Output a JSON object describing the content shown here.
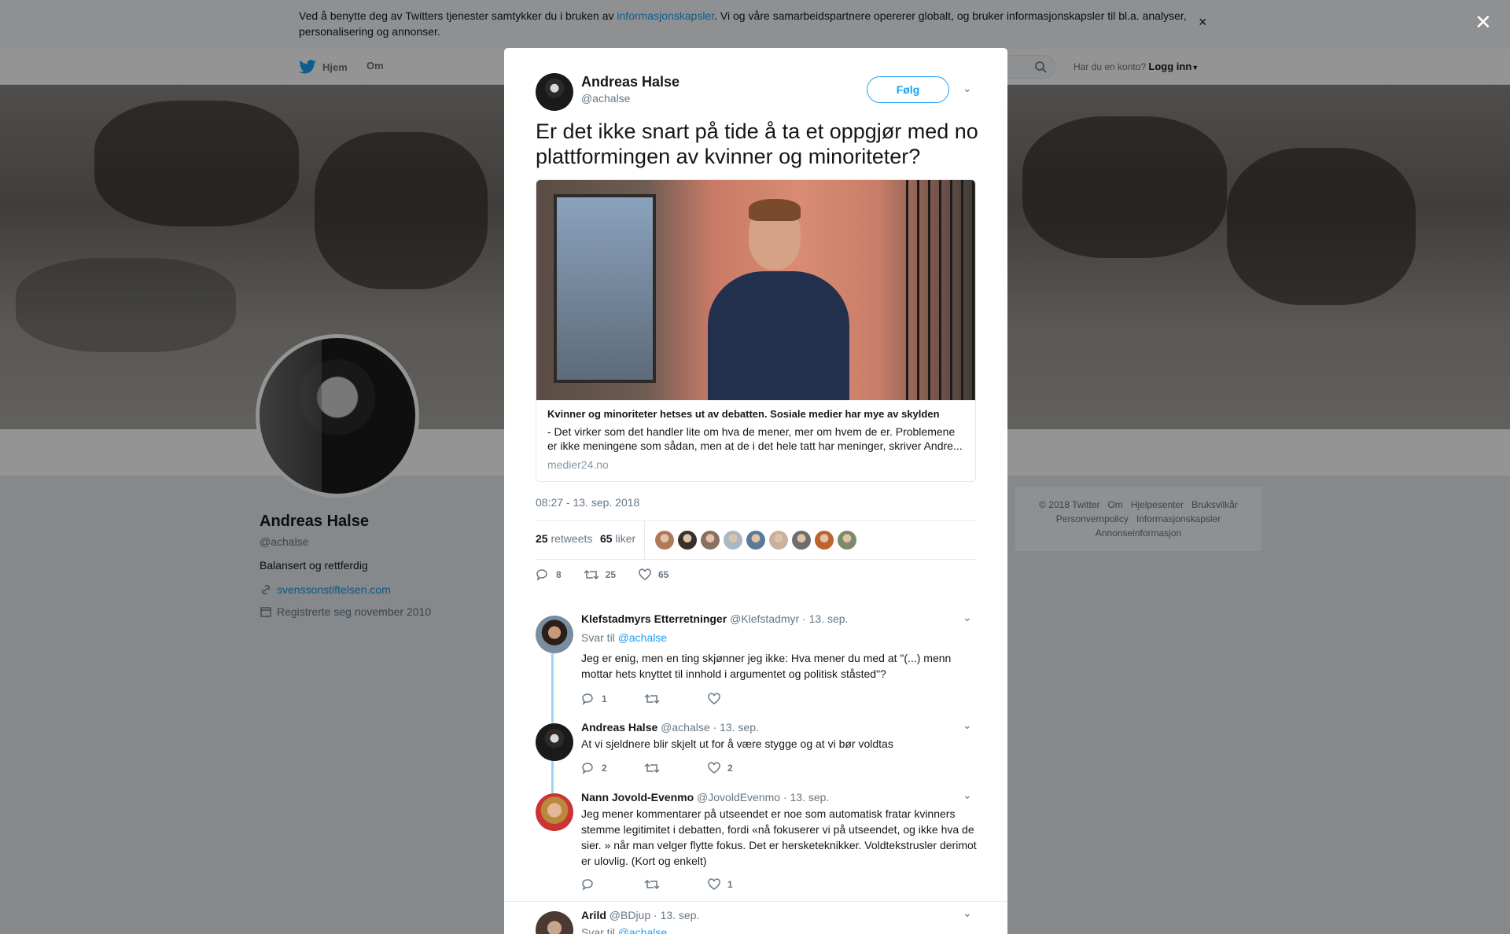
{
  "cookie": {
    "text_before": "Ved å benytte deg av Twitters tjenester samtykker du i bruken av ",
    "link": "informasjonskapsler",
    "text_after": ". Vi og våre samarbeidspartnere opererer globalt, og bruker informasjonskapsler til bl.a. analyser, personalisering og annonser.",
    "close": "×"
  },
  "nav": {
    "home": "Hjem",
    "about": "Om",
    "have_account": "Har du en konto?",
    "login": "Logg inn"
  },
  "profile": {
    "name": "Andreas Halse",
    "handle": "@achalse",
    "bio": "Balansert og rettferdig",
    "website": "svenssonstiftelsen.com",
    "joined": "Registrerte seg november 2010"
  },
  "footer": {
    "items": [
      "© 2018 Twitter",
      "Om",
      "Hjelpesenter",
      "Bruksvilkår",
      "Personvernpolicy",
      "Informasjonskapsler",
      "Annonseinformasjon"
    ]
  },
  "overlay_close": "✕",
  "tweet": {
    "author_name": "Andreas Halse",
    "author_handle": "@achalse",
    "follow_label": "Følg",
    "text": "Er det ikke snart på tide å ta et oppgjør med no plattformingen av kvinner og minoriteter?",
    "card": {
      "title": "Kvinner og minoriteter hetses ut av debatten. Sosiale medier har mye av skylden",
      "description": "- Det virker som det handler lite om hva de mener, mer om hvem de er. Problemene er ikke meningene som sådan, men at de i det hele tatt har meninger, skriver Andre...",
      "domain": "medier24.no"
    },
    "timestamp": "08:27 - 13. sep. 2018",
    "retweets_count": "25",
    "retweets_label": "retweets",
    "likes_count": "65",
    "likes_label": "liker",
    "liker_colors": [
      "#b07a5a",
      "#3b2f2a",
      "#8a7060",
      "#aab8c2",
      "#5b7a9a",
      "#c9b0a0",
      "#6e6e6e",
      "#c0622d",
      "#7a8a6a"
    ],
    "actions": {
      "replies": "8",
      "retweets": "25",
      "likes": "65"
    }
  },
  "replies": [
    {
      "name": "Klefstadmyrs Etterretninger",
      "handle": "@Klefstadmyr",
      "date": "· 13. sep.",
      "reply_to_label": "Svar til",
      "reply_to": "@achalse",
      "text": "Jeg er enig, men en ting skjønner jeg ikke: Hva mener du med at \"(...) menn mottar hets knyttet til innhold i argumentet og politisk ståsted\"?",
      "replies": "1",
      "retweets": "",
      "likes": ""
    },
    {
      "name": "Andreas Halse",
      "handle": "@achalse",
      "date": "· 13. sep.",
      "text": "At vi sjeldnere blir skjelt ut for å være stygge og at vi bør voldtas",
      "replies": "2",
      "retweets": "",
      "likes": "2"
    },
    {
      "name": "Nann Jovold-Evenmo",
      "handle": "@JovoldEvenmo",
      "date": "· 13. sep.",
      "text": "Jeg mener kommentarer på utseendet er noe som automatisk fratar kvinners stemme legitimitet i debatten, fordi «nå fokuserer vi på utseendet, og ikke hva de sier. » når man velger flytte fokus. Det er hersketeknikker. Voldtekstrusler derimot er ulovlig. (Kort og enkelt)",
      "replies": "",
      "retweets": "",
      "likes": "1"
    },
    {
      "name": "Arild",
      "handle": "@BDjup",
      "date": "· 13. sep.",
      "reply_to_label": "Svar til",
      "reply_to": "@achalse"
    }
  ]
}
